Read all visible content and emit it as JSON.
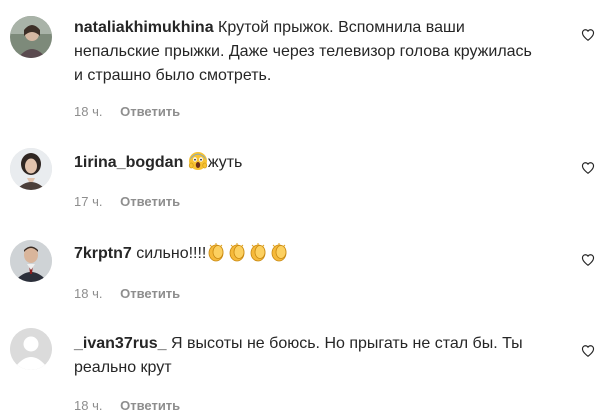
{
  "comments": [
    {
      "username": "nataliakhimukhina",
      "text": "Крутой прыжок. Вспомнила ваши непальские прыжки. Даже через телевизор голова кружилась и страшно было смотреть.",
      "time": "18 ч.",
      "reply": "Ответить",
      "avatar": "avatar-woman-outdoors"
    },
    {
      "username": "1irina_bogdan",
      "text_after_emoji": "жуть",
      "emoji": "face-screaming-in-fear",
      "time": "17 ч.",
      "reply": "Ответить",
      "avatar": "avatar-woman-portrait"
    },
    {
      "username": "7krptn7",
      "text": "сильно!!!!",
      "emoji": "clapping-hands x4",
      "time": "18 ч.",
      "reply": "Ответить",
      "avatar": "avatar-man-portrait"
    },
    {
      "username": "_ivan37rus_",
      "text": "Я высоты не боюсь. Но прыгать не стал бы. Ты реально крут",
      "time": "18 ч.",
      "reply": "Ответить",
      "avatar": "default-avatar"
    }
  ],
  "icons": {
    "like": "heart-outline-icon"
  },
  "colors": {
    "text": "#262626",
    "secondary": "#8e8e8e",
    "heart": "#262626",
    "background": "#ffffff"
  }
}
